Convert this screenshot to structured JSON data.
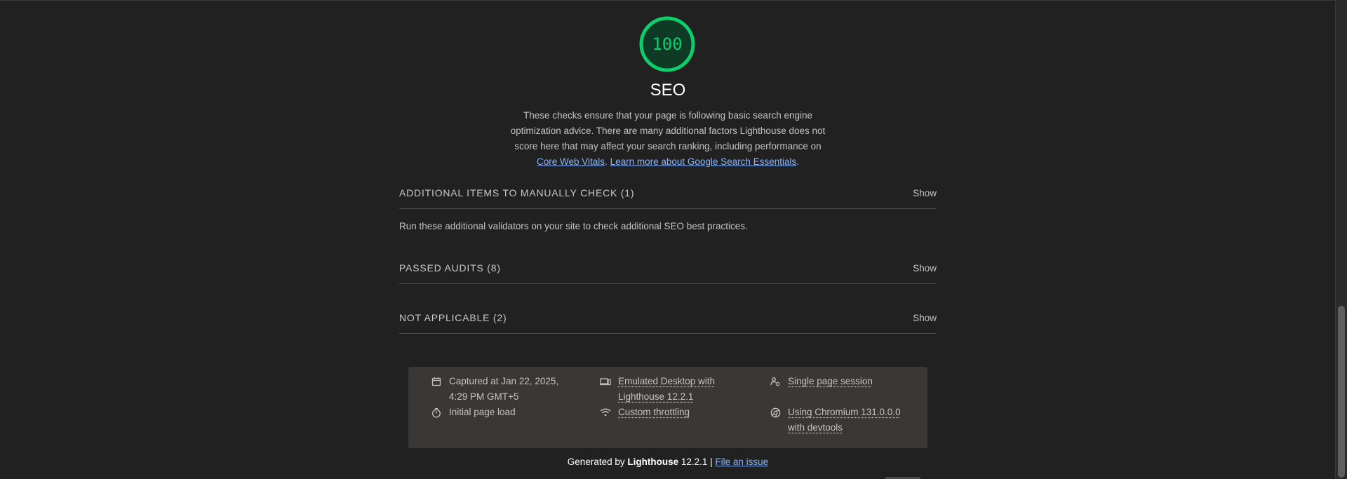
{
  "category": {
    "score": "100",
    "title": "SEO",
    "description_1": "These checks ensure that your page is following basic search engine optimization advice. There are many additional factors Lighthouse does not score here that may affect your search ranking, including performance on ",
    "link_core_web_vitals": "Core Web Vitals",
    "description_sep": ". ",
    "link_learn_more": "Learn more about Google Search Essentials",
    "description_end": ".",
    "score_color": "#0cce6b"
  },
  "groups": [
    {
      "title": "ADDITIONAL ITEMS TO MANUALLY CHECK (1)",
      "action": "Show",
      "description": "Run these additional validators on your site to check additional SEO best practices."
    },
    {
      "title": "PASSED AUDITS (8)",
      "action": "Show"
    },
    {
      "title": "NOT APPLICABLE (2)",
      "action": "Show"
    }
  ],
  "environment": {
    "captured": "Captured at Jan 22, 2025, 4:29 PM GMT+5",
    "load": "Initial page load",
    "emulation": "Emulated Desktop with Lighthouse 12.2.1",
    "throttling": "Custom throttling",
    "session": "Single page session",
    "browser": "Using Chromium 131.0.0.0 with devtools",
    "icons": [
      "calendar-icon",
      "stopwatch-icon",
      "devices-icon",
      "wifi-icon",
      "user-session-icon",
      "chromium-icon"
    ]
  },
  "footer": {
    "generated_by": "Generated by ",
    "product": "Lighthouse",
    "version": " 12.2.1 | ",
    "file_issue": "File an issue"
  }
}
